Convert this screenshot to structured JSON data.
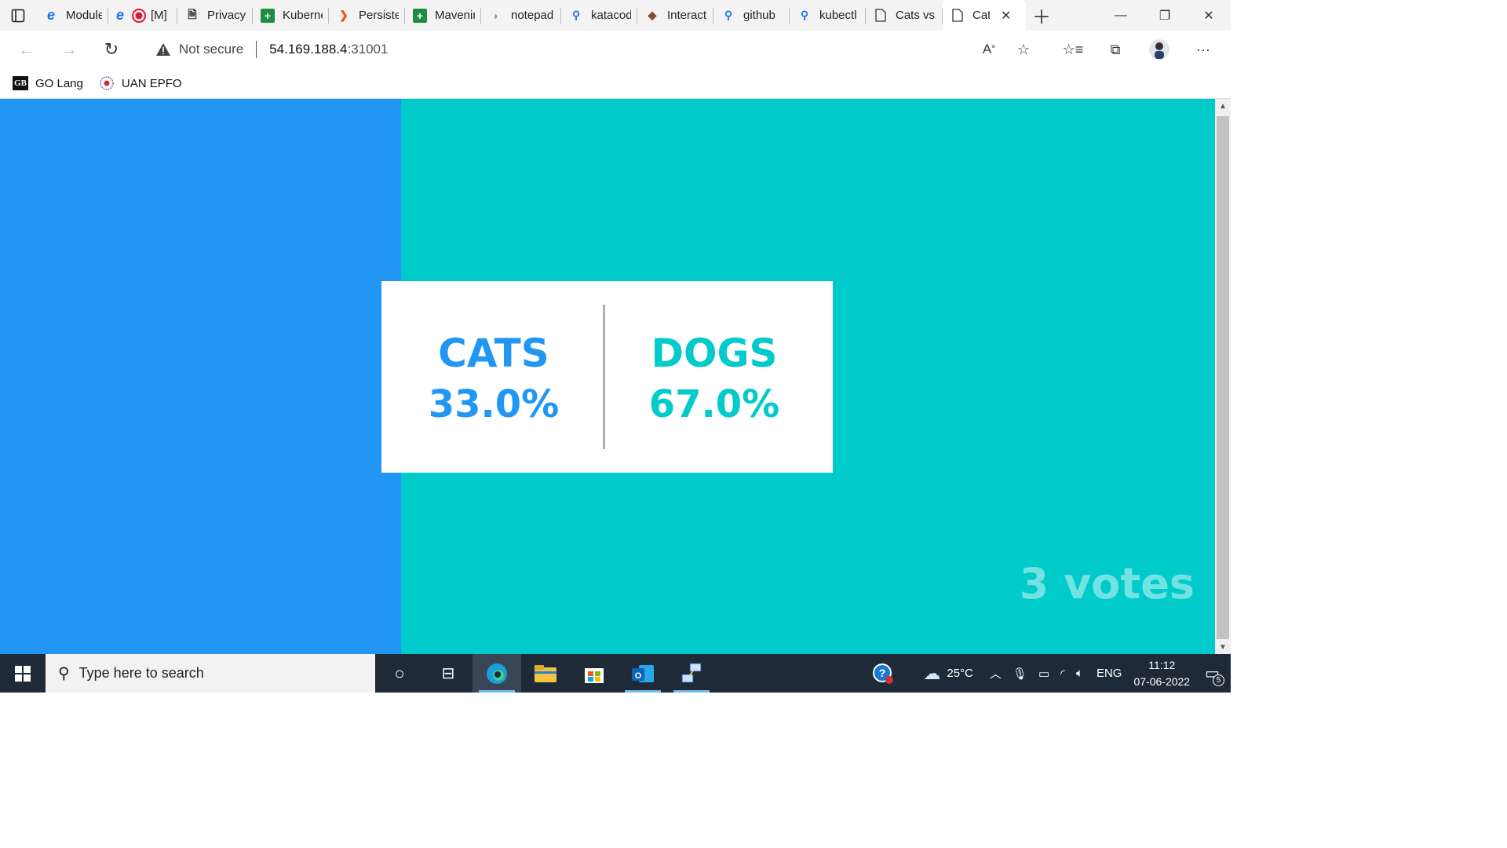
{
  "browser": {
    "tabs": [
      {
        "label": "",
        "icon": "tab-actions-icon"
      },
      {
        "label": "Module",
        "icon": "edge-icon"
      },
      {
        "label": "[M]",
        "icon": "edge-record-icon"
      },
      {
        "label": "Privacy",
        "icon": "privacy-icon"
      },
      {
        "label": "Kuberne",
        "icon": "green-plus-icon"
      },
      {
        "label": "Persiste",
        "icon": "orange-icon"
      },
      {
        "label": "Mavenir",
        "icon": "green-plus-icon"
      },
      {
        "label": "notepad",
        "icon": "notepad-icon"
      },
      {
        "label": "katacod",
        "icon": "search-icon"
      },
      {
        "label": "Interact",
        "icon": "interact-icon"
      },
      {
        "label": "github",
        "icon": "search-icon"
      },
      {
        "label": "kubectl",
        "icon": "search-icon"
      },
      {
        "label": "Cats vs",
        "icon": "page-icon"
      },
      {
        "label": "Cat",
        "icon": "page-icon",
        "active": true
      }
    ],
    "address": {
      "security_label": "Not secure",
      "url_host": "54.169.188.4",
      "url_port": ":31001"
    },
    "bookmarks": [
      {
        "label": "GO Lang",
        "badge": "GB"
      },
      {
        "label": "UAN EPFO"
      }
    ]
  },
  "page": {
    "left_color": "#2196f3",
    "right_color": "#00cbca",
    "options": [
      {
        "name": "CATS",
        "percent": "33.0%"
      },
      {
        "name": "DOGS",
        "percent": "67.0%"
      }
    ],
    "votes_label": "3 votes"
  },
  "taskbar": {
    "search_placeholder": "Type here to search",
    "weather": "25°C",
    "language": "ENG",
    "time": "11:12",
    "date": "07-06-2022",
    "notification_count": "5"
  }
}
